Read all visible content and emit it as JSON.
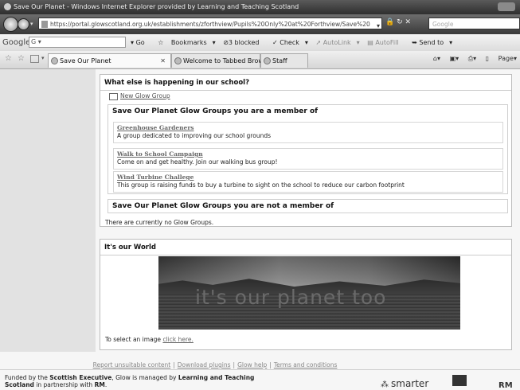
{
  "window": {
    "title": "Save Our Planet - Windows Internet Explorer provided by Learning and Teaching Scotland"
  },
  "addressbar": {
    "url": "https://portal.glowscotland.org.uk/establishments/zforthview/Pupils%20Only%20at%20Forthview/Save%20",
    "search_placeholder": "Google"
  },
  "googlebar": {
    "logo": "Google",
    "search_value": "G",
    "go_label": "Go",
    "bookmarks_label": "Bookmarks",
    "blocked_label": "3 blocked",
    "check_label": "Check",
    "autolink_label": "AutoLink",
    "autofill_label": "AutoFill",
    "sendto_label": "Send to"
  },
  "tabs": [
    {
      "label": "Save Our Planet"
    },
    {
      "label": "Welcome to Tabbed Brow..."
    },
    {
      "label": "Staff"
    }
  ],
  "commandbar": {
    "page_label": "Page"
  },
  "school_panel": {
    "header": "What else is happening in our school?",
    "new_group_label": "New Glow Group",
    "member_heading": "Save Our Planet Glow Groups you are a member of",
    "groups": [
      {
        "name": "Greenhouse Gardeners",
        "description": "A group dedicated to improving our school grounds"
      },
      {
        "name": "Walk to School Campaign",
        "description": "Come on and get healthy. Join our walking bus group!"
      },
      {
        "name": "Wind Turbine Challege",
        "description": "This group is raising funds to buy a turbine to sight on the school to reduce our carbon footprint"
      }
    ],
    "nonmember_heading": "Save Our Planet Glow Groups you are not a member of",
    "no_groups_text": "There are currently no Glow Groups."
  },
  "world_panel": {
    "header": "It's our World",
    "banner_text": "it's our planet too",
    "select_prefix": "To select an image",
    "select_link": "click here."
  },
  "footer": {
    "links": [
      "Report unsuitable content",
      "Download plugins",
      "Glow help",
      "Terms and conditions"
    ],
    "funded_1": "Funded by the ",
    "funded_exec": "Scottish Executive",
    "funded_2": ", Glow is managed by ",
    "funded_ltl": "Learning and Teaching Scotland",
    "funded_3": " in partnership with ",
    "funded_rm": "RM",
    "funded_4": ".",
    "smarter_label": "smarter",
    "rm_logo": "RM"
  }
}
